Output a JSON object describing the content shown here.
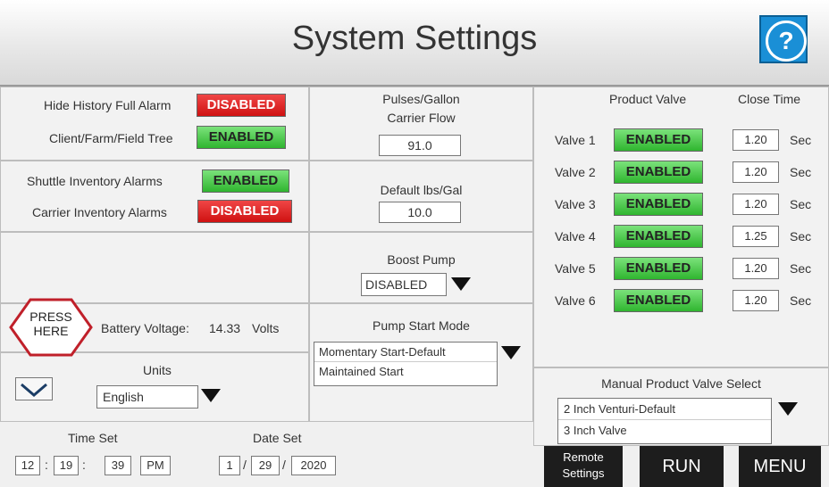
{
  "header": {
    "title": "System Settings",
    "help_icon": "question-mark-icon"
  },
  "alarms": {
    "hide_history": {
      "label": "Hide History Full Alarm",
      "status": "DISABLED"
    },
    "cff_tree": {
      "label": "Client/Farm/Field Tree",
      "status": "ENABLED"
    },
    "shuttle_inventory": {
      "label": "Shuttle Inventory Alarms",
      "status": "ENABLED"
    },
    "carrier_inventory": {
      "label": "Carrier Inventory Alarms",
      "status": "DISABLED"
    }
  },
  "press_here": {
    "line1": "PRESS",
    "line2": "HERE"
  },
  "battery": {
    "label": "Battery Voltage:",
    "value": "14.33",
    "unit": "Volts"
  },
  "units": {
    "label": "Units",
    "value": "English"
  },
  "pulses": {
    "title_line1": "Pulses/Gallon",
    "title_line2": "Carrier Flow",
    "value": "91.0"
  },
  "default_lbs": {
    "title": "Default lbs/Gal",
    "value": "10.0"
  },
  "boost_pump": {
    "title": "Boost Pump",
    "value": "DISABLED"
  },
  "pump_start": {
    "title": "Pump Start Mode",
    "options": [
      "Momentary Start-Default",
      "Maintained Start"
    ]
  },
  "valves": {
    "product_header": "Product Valve",
    "close_header": "Close Time",
    "unit": "Sec",
    "items": [
      {
        "label": "Valve 1",
        "status": "ENABLED",
        "time": "1.20"
      },
      {
        "label": "Valve 2",
        "status": "ENABLED",
        "time": "1.20"
      },
      {
        "label": "Valve 3",
        "status": "ENABLED",
        "time": "1.20"
      },
      {
        "label": "Valve 4",
        "status": "ENABLED",
        "time": "1.25"
      },
      {
        "label": "Valve 5",
        "status": "ENABLED",
        "time": "1.20"
      },
      {
        "label": "Valve 6",
        "status": "ENABLED",
        "time": "1.20"
      }
    ]
  },
  "manual_valve": {
    "title": "Manual Product Valve Select",
    "options": [
      "2 Inch Venturi-Default",
      "3 Inch Valve"
    ]
  },
  "time_set": {
    "label": "Time Set",
    "hour": "12",
    "minute": "19",
    "second": "39",
    "ampm": "PM",
    "sep": ":"
  },
  "date_set": {
    "label": "Date Set",
    "month": "1",
    "day": "29",
    "year": "2020",
    "sep": "/"
  },
  "buttons": {
    "remote_line1": "Remote",
    "remote_line2": "Settings",
    "run": "RUN",
    "menu": "MENU"
  },
  "colors": {
    "enabled": "#2fb52f",
    "disabled": "#cf1111",
    "help": "#1a8fd6",
    "press_here": "#c0202a"
  }
}
